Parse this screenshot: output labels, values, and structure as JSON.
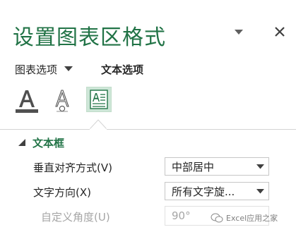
{
  "pane": {
    "title": "设置图表区格式"
  },
  "header_icons": {
    "pin": "chevron-down-icon",
    "close": "close-icon"
  },
  "tabs": {
    "chart_options": "图表选项",
    "text_options": "文本选项"
  },
  "icon_tabs": [
    {
      "name": "text-fill-outline-icon",
      "selected": false
    },
    {
      "name": "text-effects-icon",
      "selected": false
    },
    {
      "name": "textbox-icon",
      "selected": true
    }
  ],
  "section": {
    "title": "文本框",
    "expanded": true
  },
  "fields": {
    "vertical_alignment": {
      "label": "垂直对齐方式(V)",
      "value": "中部居中"
    },
    "text_direction": {
      "label": "文字方向(X)",
      "value": "所有文字旋..."
    },
    "custom_angle": {
      "label": "自定义角度(U)",
      "value": "90°",
      "disabled": true
    }
  },
  "watermark": {
    "text": "Excel应用之家"
  },
  "colors": {
    "accent": "#217346",
    "selected_tab_bg": "#cde6d7",
    "disabled_text": "#a6a6a6"
  }
}
